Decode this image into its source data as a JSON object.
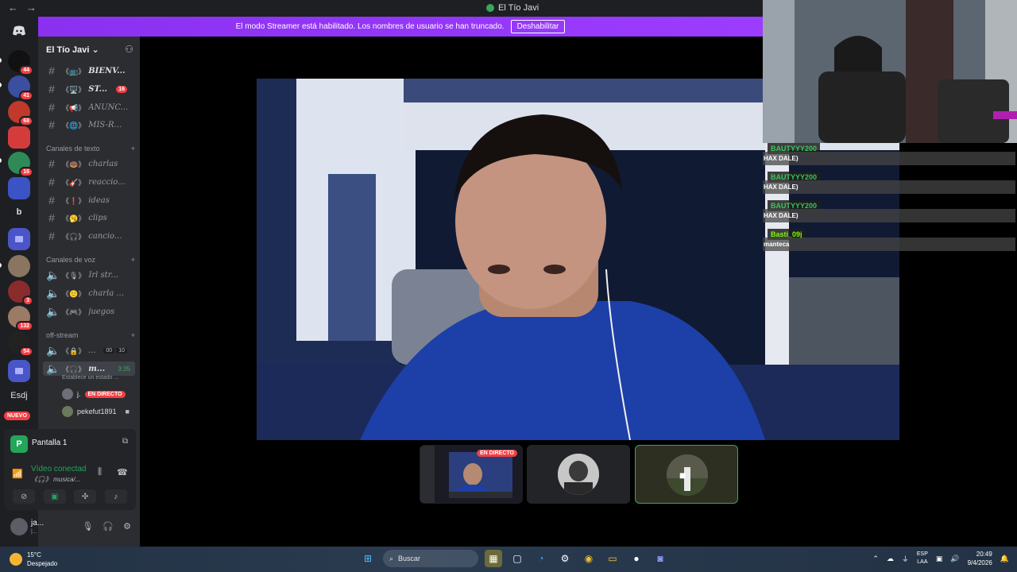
{
  "window": {
    "title": "El Tío Javi"
  },
  "banner": {
    "text": "El modo Streamer está habilitado. Los nombres de usuario se han truncado.",
    "button": "Deshabilitar"
  },
  "rail": {
    "badges": [
      "44",
      "41",
      "68",
      "16",
      "3",
      "132",
      "54"
    ],
    "text_icon": "Esdj",
    "letter_icon": "b",
    "new_label": "NUEVO"
  },
  "server": {
    "name": "El Tío Javi"
  },
  "channels_top": [
    {
      "emoji": "《📺》",
      "name": "BIENV...",
      "bold": true
    },
    {
      "emoji": "《🖥️》",
      "name": "ST...",
      "bold": true,
      "badge": "16"
    },
    {
      "emoji": "《📢》",
      "name": "ANUNC..."
    },
    {
      "emoji": "《🌐》",
      "name": "MIS-R..."
    }
  ],
  "text_category": "Canales de texto",
  "text_channels": [
    {
      "emoji": "《🍩》",
      "name": "charlas"
    },
    {
      "emoji": "《🎸》",
      "name": "reaccio..."
    },
    {
      "emoji": "《❗》",
      "name": "ideas"
    },
    {
      "emoji": "《🥱》",
      "name": "clips"
    },
    {
      "emoji": "《🎧》",
      "name": "cancio..."
    }
  ],
  "voice_category": "Canales de voz",
  "voice_channels": [
    {
      "emoji": "《🎙》",
      "name": "Irl str..."
    },
    {
      "emoji": "《🙂》",
      "name": "charla ..."
    },
    {
      "emoji": "《🎮》",
      "name": "juegos"
    }
  ],
  "off_category": "off-stream",
  "off_channels": [
    {
      "emoji": "《🔒》",
      "name": "...",
      "c1": "00",
      "c2": "10"
    },
    {
      "emoji": "《🎧》",
      "name": "m...",
      "time": "3:35",
      "status": "Establece un estado ..."
    }
  ],
  "voice_users": [
    {
      "name": "j.",
      "live": "EN DIRECTO"
    },
    {
      "name": "pekefut1891"
    }
  ],
  "voice_panel": {
    "screen_letter": "P",
    "screen_name": "Pantalla 1",
    "connected": "Vídeo conectad",
    "channel": "《🎧》 musica/..."
  },
  "user": {
    "name": "ja...",
    "status": "|..."
  },
  "tiles": [
    {
      "live": "EN DIRECTO"
    }
  ],
  "chat": [
    {
      "user": "BAUTYYY200",
      "text": "HAX DALE)"
    },
    {
      "user": "BAUTYYY200",
      "text": "HAX DALE)"
    },
    {
      "user": "BAUTYYY200",
      "text": "HAX DALE)"
    },
    {
      "user": "Basti_09j",
      "text": "manteca"
    }
  ],
  "taskbar": {
    "temp": "15°C",
    "weather": "Despejado",
    "search": "Buscar",
    "lang1": "ESP",
    "lang2": "LAA",
    "time": "20:49",
    "date": "9/4/2026"
  }
}
